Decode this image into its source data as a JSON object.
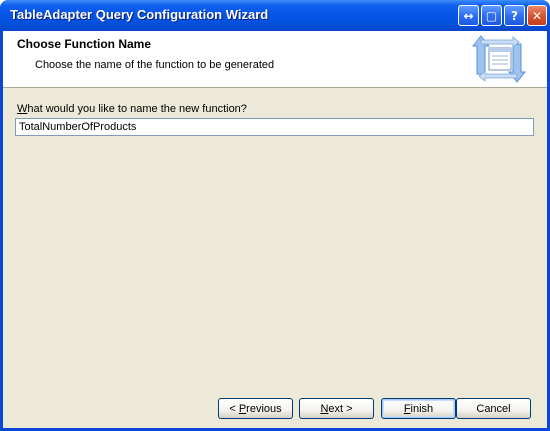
{
  "window": {
    "title": "TableAdapter Query Configuration Wizard",
    "controls": {
      "context_help": "↔",
      "restore": "▢",
      "help": "?",
      "close": "✕"
    }
  },
  "header": {
    "title": "Choose Function Name",
    "subtitle": "Choose the name of the function to be generated",
    "icon": "tableadapter-wizard-icon"
  },
  "form": {
    "prompt_accesskey": "W",
    "prompt_rest": "hat would you like to name the new function?",
    "function_name_value": "TotalNumberOfProducts"
  },
  "buttons": {
    "previous_prefix": "< ",
    "previous_accesskey": "P",
    "previous_rest": "revious",
    "next_accesskey": "N",
    "next_rest": "ext >",
    "finish_accesskey": "F",
    "finish_rest": "inish",
    "cancel": "Cancel"
  },
  "colors": {
    "titlebar": "#0554e6",
    "client_bg": "#ece9d8",
    "button_border": "#003c74"
  }
}
